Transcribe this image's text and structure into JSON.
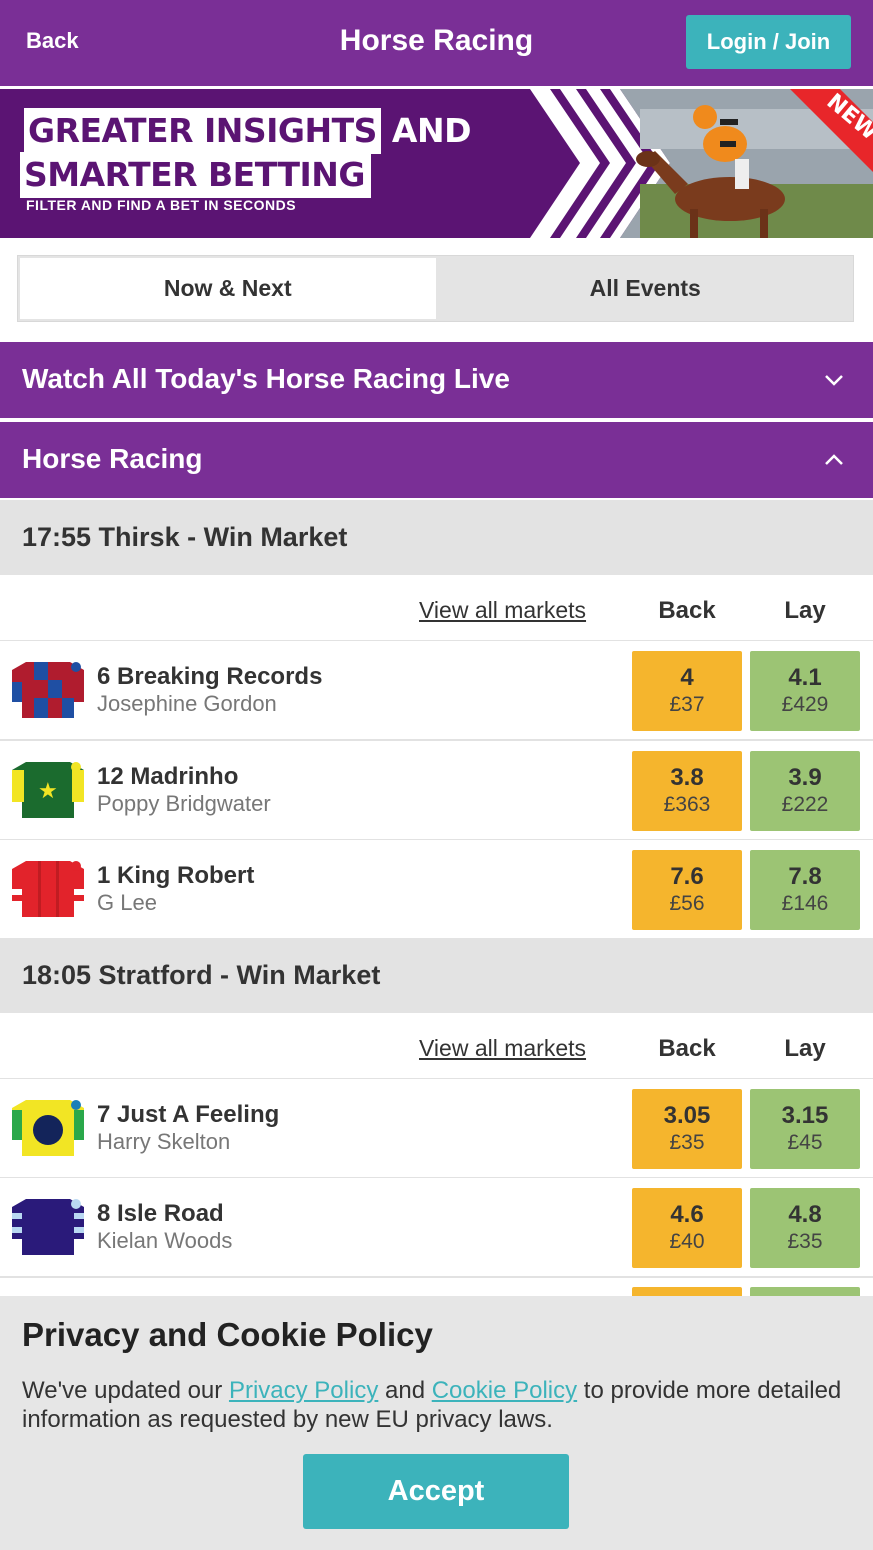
{
  "header": {
    "back_label": "Back",
    "title": "Horse Racing",
    "login_label": "Login / Join"
  },
  "banner": {
    "line1_boxed": "GREATER INSIGHTS",
    "line1_rest": "AND",
    "line2": "SMARTER BETTING",
    "subline": "FILTER AND FIND A BET IN SECONDS",
    "ribbon": "NEW"
  },
  "tabs": [
    {
      "label": "Now & Next",
      "active": true
    },
    {
      "label": "All Events",
      "active": false
    }
  ],
  "sections": {
    "watch_live": "Watch All Today's Horse Racing Live",
    "horse_racing": "Horse Racing"
  },
  "columns": {
    "view_all": "View all markets",
    "back": "Back",
    "lay": "Lay"
  },
  "races": [
    {
      "title": "17:55 Thirsk - Win Market",
      "runners": [
        {
          "name": "6 Breaking Records",
          "jockey": "Josephine Gordon",
          "back_price": "4",
          "back_stake": "£37",
          "lay_price": "4.1",
          "lay_stake": "£429"
        },
        {
          "name": "12 Madrinho",
          "jockey": "Poppy Bridgwater",
          "back_price": "3.8",
          "back_stake": "£363",
          "lay_price": "3.9",
          "lay_stake": "£222"
        },
        {
          "name": "1 King Robert",
          "jockey": "G Lee",
          "back_price": "7.6",
          "back_stake": "£56",
          "lay_price": "7.8",
          "lay_stake": "£146"
        }
      ]
    },
    {
      "title": "18:05 Stratford - Win Market",
      "runners": [
        {
          "name": "7 Just A Feeling",
          "jockey": "Harry Skelton",
          "back_price": "3.05",
          "back_stake": "£35",
          "lay_price": "3.15",
          "lay_stake": "£45"
        },
        {
          "name": "8 Isle Road",
          "jockey": "Kielan Woods",
          "back_price": "4.6",
          "back_stake": "£40",
          "lay_price": "4.8",
          "lay_stake": "£35"
        }
      ]
    }
  ],
  "cookie": {
    "title": "Privacy and Cookie Policy",
    "text_before": "We've updated our ",
    "privacy_link": "Privacy Policy",
    "text_mid": " and ",
    "cookie_link": "Cookie Policy",
    "text_after": " to provide more detailed information as requested by new EU privacy laws.",
    "accept_label": "Accept"
  },
  "colors": {
    "brand_purple": "#7a2f96",
    "accent_teal": "#3cb3bb",
    "back_orange": "#f5b52d",
    "lay_green": "#9cc474"
  },
  "icons": {
    "watch_live_chevron": "chevron-down-icon",
    "horse_racing_chevron": "chevron-up-icon"
  }
}
